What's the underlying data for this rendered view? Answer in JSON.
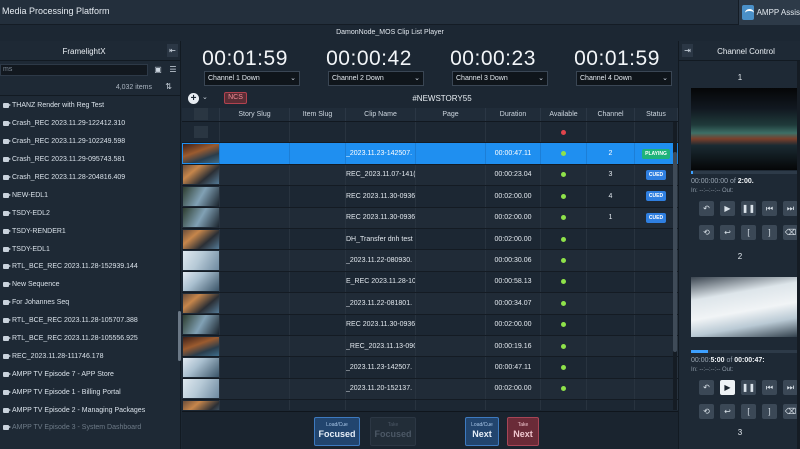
{
  "app": {
    "title": "Media Processing Platform",
    "assist_label": "AMPP Assis"
  },
  "player": {
    "title": "DamonNode_MOS Clip List Player"
  },
  "left_panel": {
    "title": "FramelightX",
    "search_placeholder": "ms",
    "item_count": "4,032 items",
    "clips": [
      "THANZ Render with Reg Test",
      "Crash_REC 2023.11.29-122412.310",
      "Crash_REC 2023.11.29-102249.598",
      "Crash_REC 2023.11.29-095743.581",
      "Crash_REC 2023.11.28-204816.409",
      "NEW-EDL1",
      "TSDY-EDL2",
      "TSDY-RENDER1",
      "TSDY-EDL1",
      "RTL_BCE_REC 2023.11.28-152939.144",
      "New Sequence",
      "For Johannes Seq",
      "RTL_BCE_REC 2023.11.28-105707.388",
      "RTL_BCE_REC 2023.11.28-105556.925",
      "REC_2023.11.28-111746.178",
      "AMPP TV Episode 7 - APP Store",
      "AMPP TV Episode 1 - Billing Portal",
      "AMPP TV Episode 2 - Managing Packages",
      "AMPP TV Episode 3 - System Dashboard"
    ]
  },
  "timers": [
    {
      "time": "00:01:59",
      "channel": "Channel 1 Down"
    },
    {
      "time": "00:00:42",
      "channel": "Channel 2 Down"
    },
    {
      "time": "00:00:23",
      "channel": "Channel 3 Down"
    },
    {
      "time": "00:01:59",
      "channel": "Channel 4 Down"
    }
  ],
  "story": {
    "ncs_label": "NCS",
    "name": "#NEWSTORY55"
  },
  "table": {
    "headers": [
      "",
      "Story Slug",
      "Item Slug",
      "Clip Name",
      "Page",
      "Duration",
      "Available",
      "Channel",
      "Status"
    ],
    "rows": [
      {
        "clip": "",
        "duration": "",
        "available": "red",
        "channel": "",
        "status": ""
      },
      {
        "clip": "_2023.11.23-142507.",
        "duration": "00:00:47.11",
        "available": "green",
        "channel": "2",
        "status": "PLAYING"
      },
      {
        "clip": "REC_2023.11.07-141(",
        "duration": "00:00:23.04",
        "available": "green",
        "channel": "3",
        "status": "CUED"
      },
      {
        "clip": "REC 2023.11.30-0936",
        "duration": "00:02:00.00",
        "available": "green",
        "channel": "4",
        "status": "CUED"
      },
      {
        "clip": "REC 2023.11.30-0936",
        "duration": "00:02:00.00",
        "available": "green",
        "channel": "1",
        "status": "CUED"
      },
      {
        "clip": "DH_Transfer dnh test",
        "duration": "00:02:00.00",
        "available": "green",
        "channel": "",
        "status": ""
      },
      {
        "clip": "_2023.11.22-080930.",
        "duration": "00:00:30.06",
        "available": "green",
        "channel": "",
        "status": ""
      },
      {
        "clip": "E_REC 2023.11.28-105",
        "duration": "00:00:58.13",
        "available": "green",
        "channel": "",
        "status": ""
      },
      {
        "clip": "_2023.11.22-081801.",
        "duration": "00:00:34.07",
        "available": "green",
        "channel": "",
        "status": ""
      },
      {
        "clip": "REC 2023.11.30-0936",
        "duration": "00:02:00.00",
        "available": "green",
        "channel": "",
        "status": ""
      },
      {
        "clip": "_REC_2023.11.13-090(",
        "duration": "00:00:19.16",
        "available": "green",
        "channel": "",
        "status": ""
      },
      {
        "clip": "_2023.11.23-142507.",
        "duration": "00:00:47.11",
        "available": "green",
        "channel": "",
        "status": ""
      },
      {
        "clip": "_2023.11.20-152137.",
        "duration": "00:02:00.00",
        "available": "green",
        "channel": "",
        "status": ""
      },
      {
        "clip": "",
        "duration": "",
        "available": "",
        "channel": "",
        "status": ""
      }
    ]
  },
  "controls": {
    "load_cue_focused": {
      "l1": "Load/Cue",
      "l2": "Focused"
    },
    "take_focused": {
      "l1": "Take",
      "l2": "Focused"
    },
    "load_cue_next": {
      "l1": "Load/Cue",
      "l2": "Next"
    },
    "take_next": {
      "l1": "Take",
      "l2": "Next"
    }
  },
  "right_panel": {
    "title": "Channel Control",
    "channels": [
      {
        "number": "1",
        "tc_a": "00:00:00:00",
        "of": "of",
        "tc_b": "2:00.",
        "out_label": "In: --:--:--:--",
        "out": "Out:",
        "progress": 0.02
      },
      {
        "number": "2",
        "tc_a": "00:00:",
        "tc_a_bold": "5:00",
        "of": "of",
        "tc_b": "00:00:47:",
        "out_label": "In: --:--:--:--",
        "out": "Out:",
        "progress": 0.15
      },
      {
        "number": "3"
      }
    ]
  }
}
